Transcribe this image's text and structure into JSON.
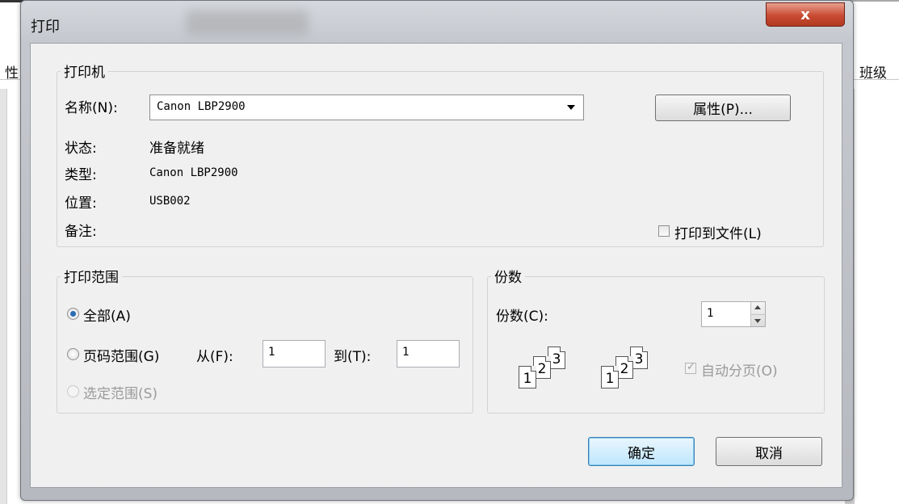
{
  "background": {
    "left_label": "性",
    "right_label": "班级"
  },
  "dialog": {
    "title": "打印",
    "close_label": "x"
  },
  "printer": {
    "group_label": "打印机",
    "name_label": "名称(N):",
    "name_value": "Canon LBP2900",
    "properties_button": "属性(P)...",
    "status_label": "状态:",
    "status_value": "准备就绪",
    "type_label": "类型:",
    "type_value": "Canon LBP2900",
    "location_label": "位置:",
    "location_value": "USB002",
    "comment_label": "备注:",
    "print_to_file_label": "打印到文件(L)",
    "print_to_file_checked": false
  },
  "print_range": {
    "group_label": "打印范围",
    "all_label": "全部(A)",
    "all_selected": true,
    "pages_label": "页码范围(G)",
    "from_label": "从(F):",
    "from_value": "1",
    "to_label": "到(T):",
    "to_value": "1",
    "selection_label": "选定范围(S)",
    "selection_enabled": false
  },
  "copies": {
    "group_label": "份数",
    "copies_label": "份数(C):",
    "copies_value": "1",
    "collate_label": "自动分页(O)",
    "collate_checked": true,
    "collate_enabled": false,
    "page_numbers": [
      "1",
      "2",
      "3"
    ]
  },
  "buttons": {
    "ok": "确定",
    "cancel": "取消"
  },
  "colors": {
    "close_button": "#c84b32",
    "default_button_border": "#3c7fb1",
    "radio_selected": "#2a6bb5"
  }
}
